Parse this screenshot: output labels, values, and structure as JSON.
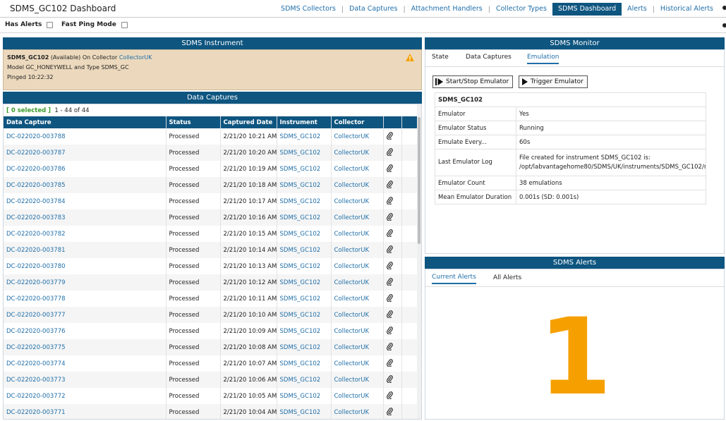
{
  "app": {
    "title": "SDMS_GC102 Dashboard"
  },
  "nav": {
    "items": [
      "SDMS Collectors",
      "Data Captures",
      "Attachment Handlers",
      "Collector Types",
      "SDMS Dashboard",
      "Alerts",
      "Historical Alerts"
    ],
    "active": "SDMS Dashboard",
    "separator": "|"
  },
  "options": {
    "has_alerts": "Has Alerts",
    "fast_ping": "Fast Ping Mode"
  },
  "instrument_panel": {
    "title": "SDMS Instrument",
    "name": "SDMS_GC102",
    "availability": "(Available)",
    "on_collector_label": "On Collector",
    "collector": "CollectorUK",
    "model_line": "Model GC_HONEYWELL and Type SDMS_GC",
    "pinged": "Pinged 10:22:32"
  },
  "data_captures": {
    "title": "Data Captures",
    "selected": "[ 0 selected ]",
    "range": "1 - 44 of 44",
    "columns": [
      "Data Capture",
      "Status",
      "Captured Date",
      "Instrument",
      "Collector"
    ],
    "rows": [
      [
        "DC-022020-003788",
        "Processed",
        "2/21/20 10:21 AM",
        "SDMS_GC102",
        "CollectorUK"
      ],
      [
        "DC-022020-003787",
        "Processed",
        "2/21/20 10:20 AM",
        "SDMS_GC102",
        "CollectorUK"
      ],
      [
        "DC-022020-003786",
        "Processed",
        "2/21/20 10:19 AM",
        "SDMS_GC102",
        "CollectorUK"
      ],
      [
        "DC-022020-003785",
        "Processed",
        "2/21/20 10:18 AM",
        "SDMS_GC102",
        "CollectorUK"
      ],
      [
        "DC-022020-003784",
        "Processed",
        "2/21/20 10:17 AM",
        "SDMS_GC102",
        "CollectorUK"
      ],
      [
        "DC-022020-003783",
        "Processed",
        "2/21/20 10:16 AM",
        "SDMS_GC102",
        "CollectorUK"
      ],
      [
        "DC-022020-003782",
        "Processed",
        "2/21/20 10:15 AM",
        "SDMS_GC102",
        "CollectorUK"
      ],
      [
        "DC-022020-003781",
        "Processed",
        "2/21/20 10:14 AM",
        "SDMS_GC102",
        "CollectorUK"
      ],
      [
        "DC-022020-003780",
        "Processed",
        "2/21/20 10:13 AM",
        "SDMS_GC102",
        "CollectorUK"
      ],
      [
        "DC-022020-003779",
        "Processed",
        "2/21/20 10:12 AM",
        "SDMS_GC102",
        "CollectorUK"
      ],
      [
        "DC-022020-003778",
        "Processed",
        "2/21/20 10:11 AM",
        "SDMS_GC102",
        "CollectorUK"
      ],
      [
        "DC-022020-003777",
        "Processed",
        "2/21/20 10:10 AM",
        "SDMS_GC102",
        "CollectorUK"
      ],
      [
        "DC-022020-003776",
        "Processed",
        "2/21/20 10:09 AM",
        "SDMS_GC102",
        "CollectorUK"
      ],
      [
        "DC-022020-003775",
        "Processed",
        "2/21/20 10:08 AM",
        "SDMS_GC102",
        "CollectorUK"
      ],
      [
        "DC-022020-003774",
        "Processed",
        "2/21/20 10:07 AM",
        "SDMS_GC102",
        "CollectorUK"
      ],
      [
        "DC-022020-003773",
        "Processed",
        "2/21/20 10:06 AM",
        "SDMS_GC102",
        "CollectorUK"
      ],
      [
        "DC-022020-003772",
        "Processed",
        "2/21/20 10:05 AM",
        "SDMS_GC102",
        "CollectorUK"
      ],
      [
        "DC-022020-003771",
        "Processed",
        "2/21/20 10:04 AM",
        "SDMS_GC102",
        "CollectorUK"
      ]
    ]
  },
  "monitor": {
    "title": "SDMS Monitor",
    "tabs": [
      "State",
      "Data Captures",
      "Emulation"
    ],
    "active_tab": "Emulation",
    "start_stop_button": "Start/Stop Emulator",
    "trigger_button": "Trigger Emulator",
    "emulation_header": "SDMS_GC102",
    "fields": [
      {
        "label": "Emulator",
        "value": "Yes"
      },
      {
        "label": "Emulator Status",
        "value": "Running"
      },
      {
        "label": "Emulate Every...",
        "value": "60s"
      },
      {
        "label": "Last Emulator Log",
        "value": "File created for instrument SDMS_GC102 is:",
        "value2": "/opt/labvantagehome80/SDMS/UK/instruments/SDMS_GC102/n"
      },
      {
        "label": "Emulator Count",
        "value": "38 emulations"
      },
      {
        "label": "Mean Emulator Duration",
        "value": "0.001s (SD: 0.001s)"
      }
    ]
  },
  "alerts": {
    "title": "SDMS Alerts",
    "tabs": [
      "Current Alerts",
      "All Alerts"
    ],
    "active_tab": "Current Alerts",
    "count": "1"
  },
  "colors": {
    "header_blue": "#0e5580",
    "link_blue": "#1f6ea8",
    "instrument_bg": "#ecd9bd",
    "alert_count": "#f5a000",
    "selected_green": "#3a9a2b"
  }
}
